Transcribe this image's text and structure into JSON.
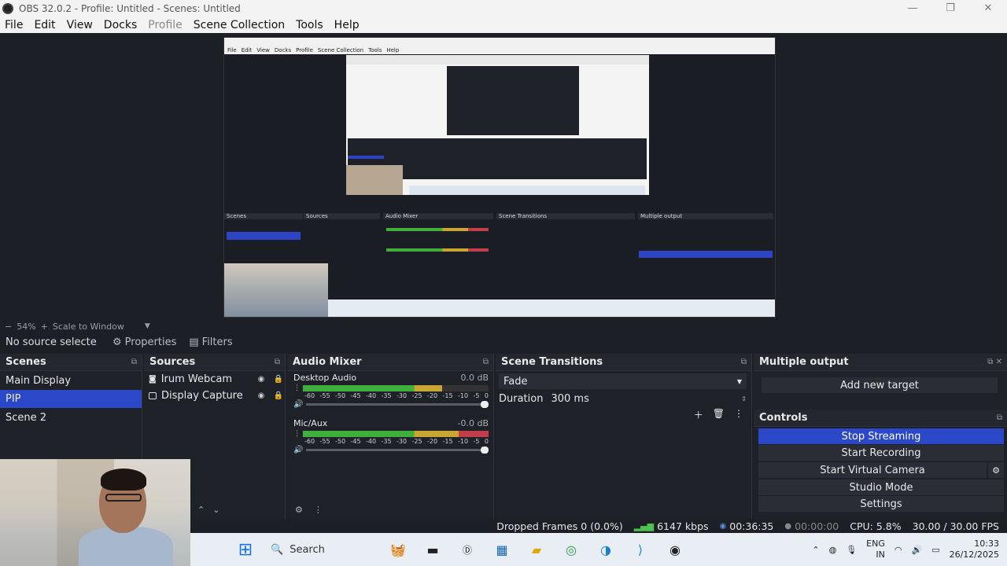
{
  "window": {
    "title": "OBS 32.0.2 - Profile: Untitled - Scenes: Untitled",
    "minimize": "—",
    "maximize": "❐",
    "close": "✕"
  },
  "menu": [
    "File",
    "Edit",
    "View",
    "Docks",
    "Profile",
    "Scene Collection",
    "Tools",
    "Help"
  ],
  "zoom": {
    "value": "54%",
    "mode": "Scale to Window"
  },
  "source_toolbar": {
    "no_source": "No source selecte",
    "properties": "Properties",
    "filters": "Filters"
  },
  "scenes": {
    "title": "Scenes",
    "items": [
      "Main Display",
      "PIP",
      "Scene 2"
    ],
    "selected": "PIP"
  },
  "sources": {
    "title": "Sources",
    "items": [
      "Irum Webcam",
      "Display Capture"
    ]
  },
  "audio_mixer": {
    "title": "Audio Mixer",
    "channels": [
      {
        "name": "Desktop Audio",
        "db": "0.0 dB",
        "level": 0.75
      },
      {
        "name": "Mic/Aux",
        "db": "-0.0 dB",
        "level": 1.0
      }
    ],
    "scale": [
      "-60",
      "-55",
      "-50",
      "-45",
      "-40",
      "-35",
      "-30",
      "-25",
      "-20",
      "-15",
      "-10",
      "-5",
      "0"
    ]
  },
  "transitions": {
    "title": "Scene Transitions",
    "selected": "Fade",
    "duration_label": "Duration",
    "duration_value": "300 ms"
  },
  "multiple_output": {
    "title": "Multiple output",
    "add_target": "Add new target"
  },
  "controls": {
    "title": "Controls",
    "buttons": [
      "Stop Streaming",
      "Start Recording",
      "Start Virtual Camera",
      "Studio Mode",
      "Settings"
    ]
  },
  "status": {
    "dropped": "Dropped Frames 0 (0.0%)",
    "kbps": "6147 kbps",
    "stream_time": "00:36:35",
    "rec_time": "00:00:00",
    "cpu": "CPU: 5.8%",
    "fps": "30.00 / 30.00 FPS"
  },
  "taskbar": {
    "search": "Search",
    "lang1": "ENG",
    "lang2": "IN",
    "time": "10:33",
    "date": "26/12/2025"
  },
  "colors": {
    "accent": "#2a48c7",
    "meter_green": "#3fae3f",
    "meter_yellow": "#c9a531",
    "meter_red": "#c23e4a"
  }
}
